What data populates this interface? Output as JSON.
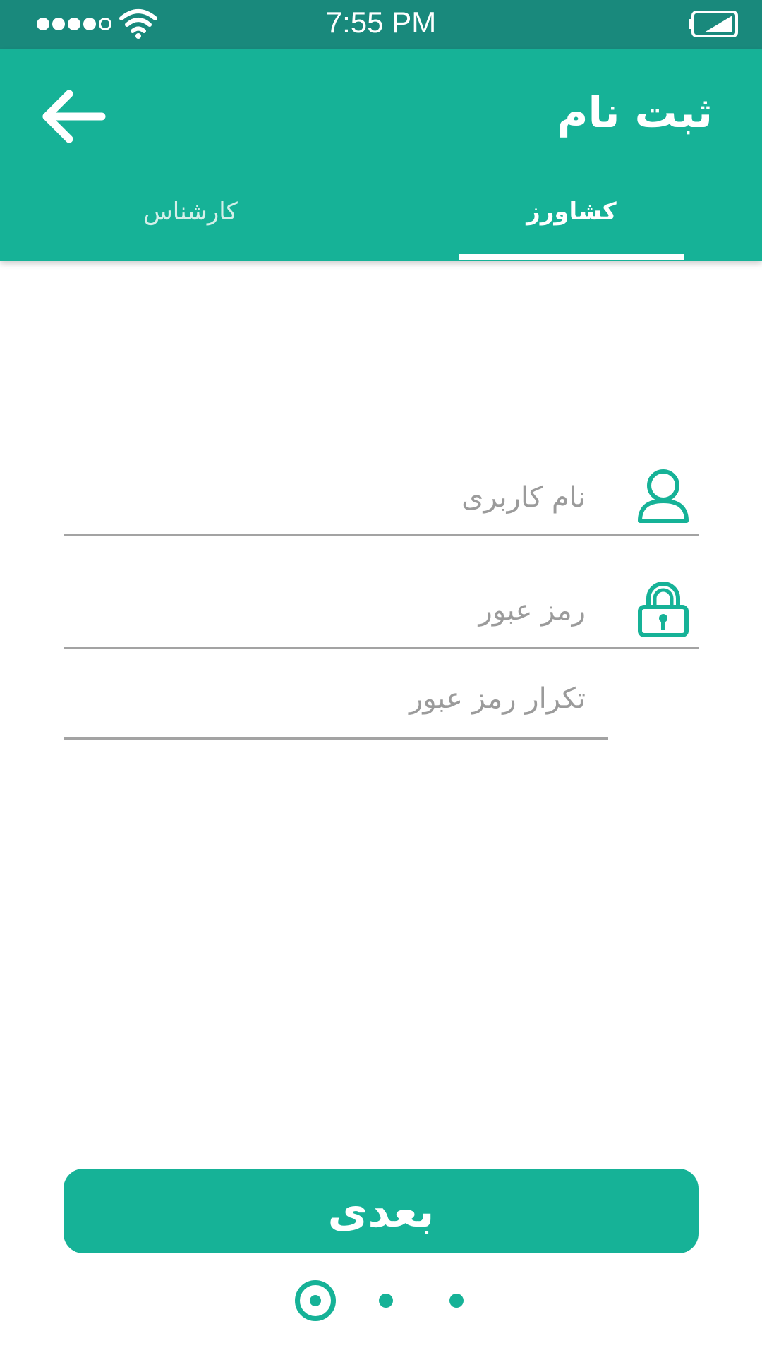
{
  "status_bar": {
    "time": "7:55 PM",
    "signal_icon": "signal-dots-icon",
    "wifi_icon": "wifi-icon",
    "battery_icon": "battery-icon",
    "signal_bars_filled": 4,
    "signal_bars_total": 5
  },
  "app_bar": {
    "title": "ثبت نام",
    "back_icon": "arrow-left-icon",
    "background_color": "#16b297",
    "tabs": [
      {
        "label": "کشاورز",
        "active": true
      },
      {
        "label": "کارشناس",
        "active": false
      }
    ]
  },
  "form": {
    "username": {
      "placeholder": "نام کاربری",
      "value": "",
      "icon": "user-icon"
    },
    "password": {
      "placeholder": "رمز عبور",
      "value": "",
      "icon": "lock-icon"
    },
    "confirm_password": {
      "placeholder": "تکرار رمز عبور",
      "value": ""
    }
  },
  "next_button": {
    "label": "بعدی",
    "color": "#16b297"
  },
  "pagination": {
    "total": 3,
    "current": 1
  }
}
